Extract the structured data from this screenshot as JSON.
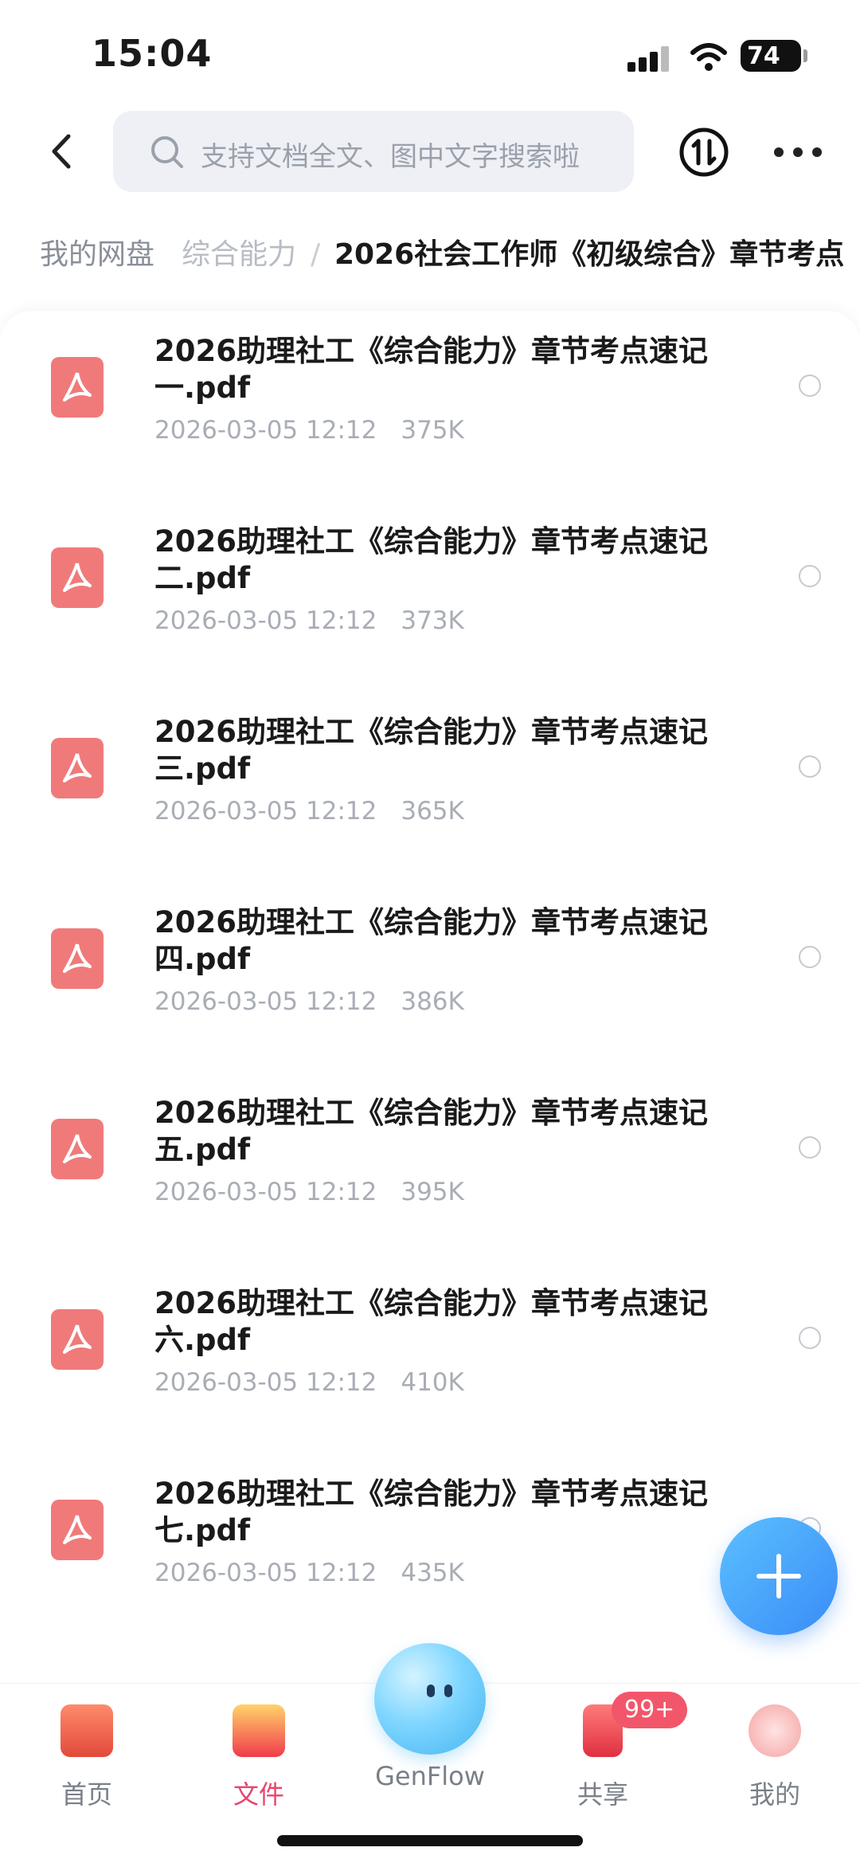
{
  "status": {
    "time": "15:04",
    "battery": "74"
  },
  "search": {
    "placeholder": "支持文档全文、图中文字搜索啦"
  },
  "breadcrumb": {
    "root": "我的网盘",
    "middle": "综合能力",
    "separator": "/",
    "current": "2026社会工作师《初级综合》章节考点"
  },
  "files": [
    {
      "name": "2026助理社工《综合能力》章节考点速记 一.pdf",
      "date": "2026-03-05 12:12",
      "size": "375K"
    },
    {
      "name": "2026助理社工《综合能力》章节考点速记 二.pdf",
      "date": "2026-03-05 12:12",
      "size": "373K"
    },
    {
      "name": "2026助理社工《综合能力》章节考点速记 三.pdf",
      "date": "2026-03-05 12:12",
      "size": "365K"
    },
    {
      "name": "2026助理社工《综合能力》章节考点速记 四.pdf",
      "date": "2026-03-05 12:12",
      "size": "386K"
    },
    {
      "name": "2026助理社工《综合能力》章节考点速记 五.pdf",
      "date": "2026-03-05 12:12",
      "size": "395K"
    },
    {
      "name": "2026助理社工《综合能力》章节考点速记 六.pdf",
      "date": "2026-03-05 12:12",
      "size": "410K"
    },
    {
      "name": "2026助理社工《综合能力》章节考点速记 七.pdf",
      "date": "2026-03-05 12:12",
      "size": "435K"
    }
  ],
  "partial_row": "2026助理社工《综合能力》章节考点速",
  "tabs": {
    "home": "首页",
    "files": "文件",
    "genflow": "GenFlow",
    "share": "共享",
    "share_badge": "99+",
    "me": "我的"
  },
  "colors": {
    "accent": "#e8456b",
    "pdf_icon": "#f07a7a",
    "fab": "#3a8cf7"
  },
  "icons": [
    "back-icon",
    "search-icon",
    "sync-icon",
    "more-icon",
    "pdf-icon",
    "add-icon"
  ]
}
